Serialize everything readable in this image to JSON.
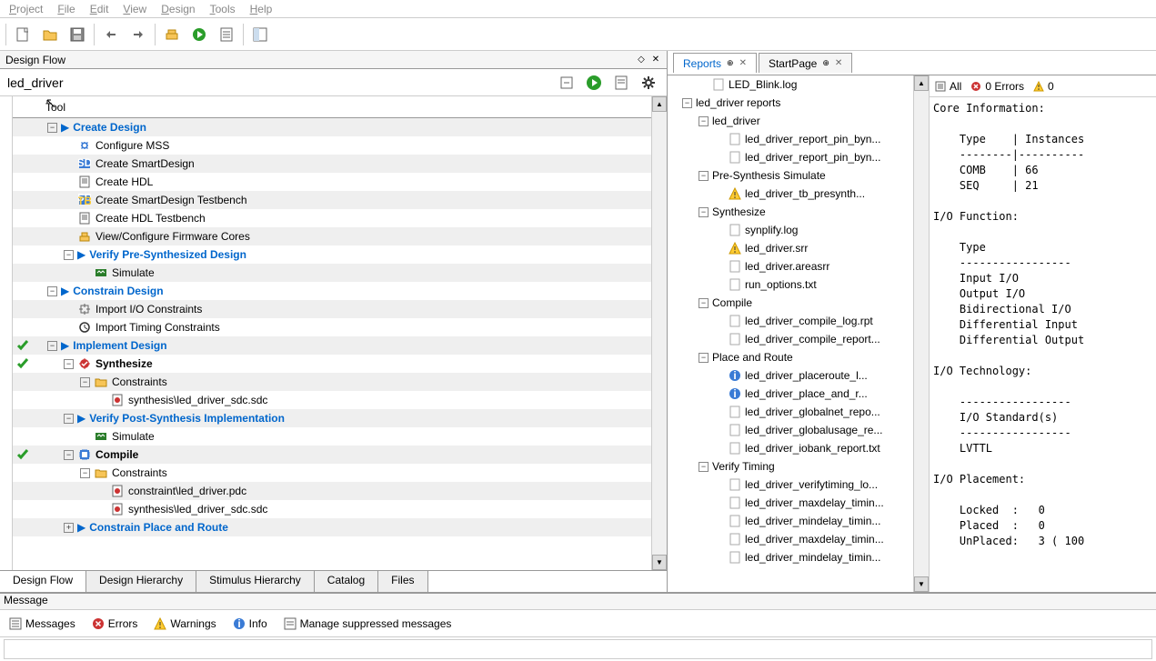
{
  "menubar": [
    "Project",
    "File",
    "Edit",
    "View",
    "Design",
    "Tools",
    "Help"
  ],
  "pane_titles": {
    "design_flow": "Design Flow",
    "message": "Message"
  },
  "project_name": "led_driver",
  "tool_header": "Tool",
  "design_tree": [
    {
      "indent": 1,
      "exp": "-",
      "arrow": true,
      "blue": true,
      "label": "Create Design",
      "ic": "",
      "int": true
    },
    {
      "indent": 2,
      "ic": "gear-blue",
      "label": "Configure MSS",
      "int": true
    },
    {
      "indent": 2,
      "ic": "sd",
      "label": "Create SmartDesign",
      "int": true
    },
    {
      "indent": 2,
      "ic": "doc",
      "label": "Create HDL",
      "int": true
    },
    {
      "indent": 2,
      "ic": "sdtb",
      "label": "Create SmartDesign Testbench",
      "int": true
    },
    {
      "indent": 2,
      "ic": "doc",
      "label": "Create HDL Testbench",
      "int": true
    },
    {
      "indent": 2,
      "ic": "cores",
      "label": "View/Configure Firmware Cores",
      "int": true
    },
    {
      "indent": 2,
      "exp": "-",
      "arrow": true,
      "blue": true,
      "label": "Verify Pre-Synthesized Design",
      "ic": "",
      "int": true
    },
    {
      "indent": 3,
      "ic": "sim",
      "label": "Simulate",
      "int": true
    },
    {
      "indent": 1,
      "exp": "-",
      "arrow": true,
      "blue": true,
      "label": "Constrain Design",
      "ic": "",
      "int": true
    },
    {
      "indent": 2,
      "ic": "impio",
      "label": "Import I/O Constraints",
      "int": true
    },
    {
      "indent": 2,
      "ic": "clock",
      "label": "Import Timing Constraints",
      "int": true
    },
    {
      "indent": 1,
      "exp": "-",
      "arrow": true,
      "blue": true,
      "label": "Implement Design",
      "ic": "",
      "int": true,
      "gutter": "check-g"
    },
    {
      "indent": 2,
      "exp": "-",
      "ic": "syn",
      "bold": true,
      "label": "Synthesize",
      "int": true,
      "gutter": "check-g2"
    },
    {
      "indent": 3,
      "exp": "-",
      "ic": "folder",
      "label": "Constraints",
      "int": true
    },
    {
      "indent": 4,
      "ic": "file-red",
      "label": "synthesis\\led_driver_sdc.sdc",
      "int": true
    },
    {
      "indent": 2,
      "exp": "-",
      "arrow": true,
      "blue": true,
      "label": "Verify Post-Synthesis Implementation",
      "ic": "",
      "int": true
    },
    {
      "indent": 3,
      "ic": "sim",
      "label": "Simulate",
      "int": true
    },
    {
      "indent": 2,
      "exp": "-",
      "ic": "comp",
      "bold": true,
      "label": "Compile",
      "int": true,
      "gutter": "check-g"
    },
    {
      "indent": 3,
      "exp": "-",
      "ic": "folder",
      "label": "Constraints",
      "int": true
    },
    {
      "indent": 4,
      "ic": "file-red",
      "label": "constraint\\led_driver.pdc",
      "int": true
    },
    {
      "indent": 4,
      "ic": "file-red",
      "label": "synthesis\\led_driver_sdc.sdc",
      "int": true
    },
    {
      "indent": 2,
      "exp": "+",
      "arrow": true,
      "blue": true,
      "label": "Constrain Place and Route",
      "ic": "",
      "int": true
    }
  ],
  "left_tabs": [
    "Design Flow",
    "Design Hierarchy",
    "Stimulus Hierarchy",
    "Catalog",
    "Files"
  ],
  "left_tab_active": 0,
  "right_tabs": [
    {
      "label": "Reports",
      "close": true,
      "active": true,
      "color": "#0066cc"
    },
    {
      "label": "StartPage",
      "close": true,
      "active": false,
      "color": "#000"
    }
  ],
  "reports_tree": [
    {
      "indent": 1,
      "ic": "txt",
      "label": "LED_Blink.log"
    },
    {
      "indent": 0,
      "exp": "-",
      "label": "led_driver reports"
    },
    {
      "indent": 1,
      "exp": "-",
      "label": "led_driver"
    },
    {
      "indent": 2,
      "ic": "txt",
      "label": "led_driver_report_pin_byn..."
    },
    {
      "indent": 2,
      "ic": "txt",
      "label": "led_driver_report_pin_byn..."
    },
    {
      "indent": 1,
      "exp": "-",
      "label": "Pre-Synthesis Simulate"
    },
    {
      "indent": 2,
      "ic": "warn",
      "label": "led_driver_tb_presynth..."
    },
    {
      "indent": 1,
      "exp": "-",
      "label": "Synthesize"
    },
    {
      "indent": 2,
      "ic": "txt",
      "label": "synplify.log"
    },
    {
      "indent": 2,
      "ic": "warn",
      "label": "led_driver.srr"
    },
    {
      "indent": 2,
      "ic": "txt",
      "label": "led_driver.areasrr"
    },
    {
      "indent": 2,
      "ic": "txt",
      "label": "run_options.txt"
    },
    {
      "indent": 1,
      "exp": "-",
      "label": "Compile"
    },
    {
      "indent": 2,
      "ic": "txt",
      "label": "led_driver_compile_log.rpt"
    },
    {
      "indent": 2,
      "ic": "txt",
      "label": "led_driver_compile_report..."
    },
    {
      "indent": 1,
      "exp": "-",
      "label": "Place and Route"
    },
    {
      "indent": 2,
      "ic": "info",
      "label": "led_driver_placeroute_l..."
    },
    {
      "indent": 2,
      "ic": "info",
      "label": "led_driver_place_and_r..."
    },
    {
      "indent": 2,
      "ic": "txt",
      "label": "led_driver_globalnet_repo..."
    },
    {
      "indent": 2,
      "ic": "txt",
      "label": "led_driver_globalusage_re..."
    },
    {
      "indent": 2,
      "ic": "txt",
      "label": "led_driver_iobank_report.txt"
    },
    {
      "indent": 1,
      "exp": "-",
      "label": "Verify Timing"
    },
    {
      "indent": 2,
      "ic": "txt",
      "label": "led_driver_verifytiming_lo..."
    },
    {
      "indent": 2,
      "ic": "txt",
      "label": "led_driver_maxdelay_timin..."
    },
    {
      "indent": 2,
      "ic": "txt",
      "label": "led_driver_mindelay_timin..."
    },
    {
      "indent": 2,
      "ic": "txt",
      "label": "led_driver_maxdelay_timin..."
    },
    {
      "indent": 2,
      "ic": "txt",
      "label": "led_driver_mindelay_timin..."
    }
  ],
  "ci_toolbar": {
    "all": "All",
    "errors": "0 Errors",
    "warn_prefix": "0"
  },
  "core_info_text": "Core Information:\n\n    Type    | Instances\n    --------|----------\n    COMB    | 66\n    SEQ     | 21\n\nI/O Function:\n\n    Type\n    -----------------\n    Input I/O\n    Output I/O\n    Bidirectional I/O\n    Differential Input\n    Differential Output\n\nI/O Technology:\n\n    -----------------\n    I/O Standard(s)\n    -----------------\n    LVTTL\n\nI/O Placement:\n\n    Locked  :   0\n    Placed  :   0\n    UnPlaced:   3 ( 100",
  "msg_toolbar": {
    "messages": "Messages",
    "errors": "Errors",
    "warnings": "Warnings",
    "info": "Info",
    "manage": "Manage suppressed messages"
  }
}
